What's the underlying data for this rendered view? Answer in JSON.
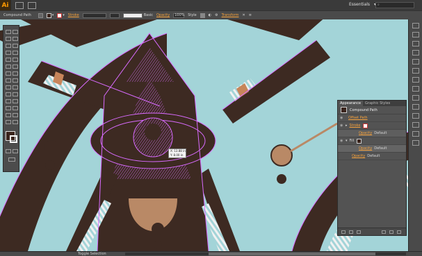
{
  "app": {
    "logo": "Ai",
    "workspace": "Essentials",
    "search_placeholder": ""
  },
  "control_bar": {
    "selection_type": "Compound Path",
    "stroke_label": "Stroke",
    "brush_label": "Basic",
    "opacity_label": "Opacity",
    "opacity_value": "100%",
    "style_label": "Style",
    "transform_label": "Transform"
  },
  "tooltip": {
    "line1": "X: 13.88 in",
    "line2": "Y: 8.00 in"
  },
  "appearance_panel": {
    "tabs": [
      "Appearance",
      "Graphic Styles"
    ],
    "title": "Compound Path",
    "rows": [
      {
        "label": "Offset Path",
        "link": true
      },
      {
        "label": "Stroke",
        "link": true
      },
      {
        "label": "Opacity",
        "value": "Default",
        "link": true,
        "sub": true
      },
      {
        "label": "Fill",
        "link": false
      },
      {
        "label": "Opacity",
        "value": "Default",
        "link": true,
        "sub": true
      },
      {
        "label": "Opacity",
        "value": "Default",
        "link": true
      }
    ]
  },
  "status_bar": {
    "zoom": "",
    "status": "Toggle Selection"
  },
  "colors": {
    "accent": "#f7a23b",
    "artwork_brown": "#3d2a22",
    "selection": "#d96bff",
    "sky": "#a3d4d8",
    "tan": "#b98966"
  }
}
